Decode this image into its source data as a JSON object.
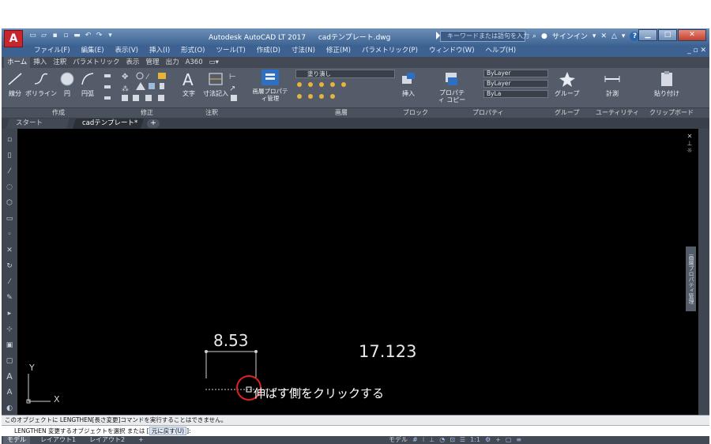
{
  "titlebar": {
    "app_title": "Autodesk AutoCAD LT 2017",
    "file_name": "cadテンプレート.dwg",
    "search_placeholder": "キーワードまたは語句を入力",
    "sign_in": "サインイン",
    "logo_letter": "A"
  },
  "menubar": {
    "items": [
      "ファイル(F)",
      "編集(E)",
      "表示(V)",
      "挿入(I)",
      "形式(O)",
      "ツール(T)",
      "作成(D)",
      "寸法(N)",
      "修正(M)",
      "パラメトリック(P)",
      "ウィンドウ(W)",
      "ヘルプ(H)"
    ]
  },
  "ribbon_tabs": {
    "items": [
      "ホーム",
      "挿入",
      "注釈",
      "パラメトリック",
      "表示",
      "管理",
      "出力",
      "A360"
    ]
  },
  "ribbon": {
    "tools": {
      "line": "線分",
      "polyline": "ポリライン",
      "circle": "円",
      "arc": "円弧",
      "text": "文字",
      "dimension": "寸法記入",
      "layer_properties": "画層プロパティ管理",
      "insert": "挿入",
      "properties": "プロパティ コピー",
      "group": "グループ",
      "measure": "計測",
      "paste": "貼り付け"
    },
    "layer_dropdown": "塗り潰し",
    "prop_color": "ByLayer",
    "prop_linetype": "ByLayer",
    "prop_lineweight": "ByLa",
    "panels": [
      "作成",
      "修正",
      "注釈",
      "画層",
      "ブロック",
      "プロパティ",
      "グループ",
      "ユーティリティ",
      "クリップボード"
    ]
  },
  "file_tabs": {
    "start": "スタート",
    "current": "cadテンプレート*",
    "add": "+"
  },
  "canvas": {
    "dimension_value_1": "8.53",
    "dimension_value_2": "17.123",
    "instruction": "伸ばす側をクリックする",
    "ucs_y": "Y",
    "ucs_x": "X",
    "properties_palette": "画層プロパティ管理"
  },
  "command": {
    "history": "このオブジェクトに LENGTHEN[長さ変更]コマンドを実行することはできません。",
    "prompt": "LENGTHEN 変更するオブジェクトを選択 または [",
    "option": "元に戻す(U)",
    "prompt_end": "]:"
  },
  "statusbar": {
    "model": "モデル",
    "layout1": "レイアウト1",
    "layout2": "レイアウト2",
    "model_space": "モデル"
  },
  "colors": {
    "canvas_bg": "#000000",
    "ribbon_bg": "#545c69",
    "title_blue": "#3f6594",
    "highlight_circle": "#e02020"
  }
}
